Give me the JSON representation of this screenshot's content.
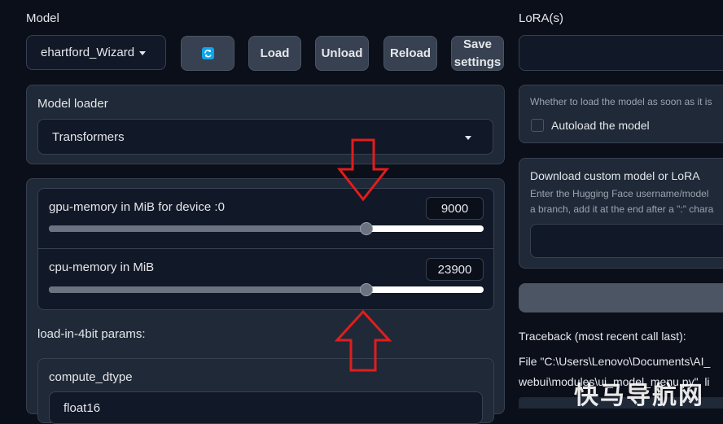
{
  "left": {
    "model_label": "Model",
    "model_value": "ehartford_Wizard",
    "buttons": {
      "refresh_icon": "refresh-icon",
      "load": "Load",
      "unload": "Unload",
      "reload": "Reload",
      "save_line1": "Save",
      "save_line2": "settings"
    },
    "loader": {
      "label": "Model loader",
      "value": "Transformers"
    },
    "gpu": {
      "label": "gpu-memory in MiB for device :0",
      "value": "9000",
      "fraction": 0.73
    },
    "cpu": {
      "label": "cpu-memory in MiB",
      "value": "23900",
      "fraction": 0.73
    },
    "params_label": "load-in-4bit params:",
    "compute_dtype_label": "compute_dtype",
    "compute_dtype_value": "float16"
  },
  "right": {
    "lora_label": "LoRA(s)",
    "autoload_hint": "Whether to load the model as soon as it is",
    "autoload_label": "Autoload the model",
    "download_title": "Download custom model or LoRA",
    "download_desc1": "Enter the Hugging Face username/model",
    "download_desc2": "a branch, add it at the end after a \":\" chara",
    "traceback_title": "Traceback (most recent call last):",
    "traceback_line1": "File \"C:\\Users\\Lenovo\\Documents\\AI_",
    "traceback_line2": "webui\\modules\\ui_model_menu.py\", li"
  },
  "watermark": "快马导航网",
  "colors": {
    "background": "#0b0f19",
    "block": "#1f2937",
    "arrow": "#e11d1d"
  }
}
